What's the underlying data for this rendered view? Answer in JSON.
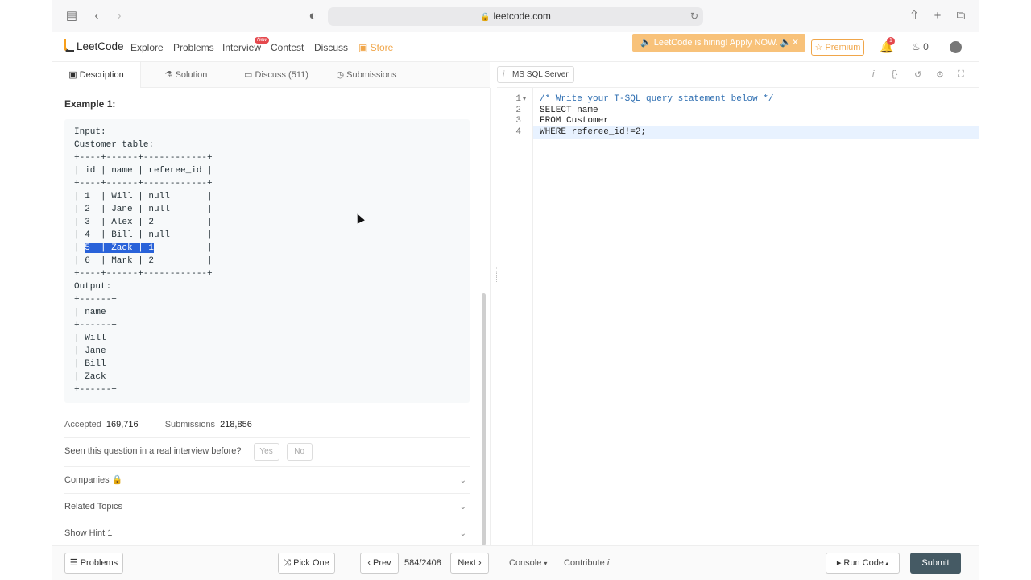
{
  "browser": {
    "url": "leetcode.com"
  },
  "nav": {
    "logo": "LeetCode",
    "links": [
      "Explore",
      "Problems",
      "Interview",
      "Contest",
      "Discuss",
      "Store"
    ],
    "new_badge": "New",
    "hiring": "LeetCode is hiring! Apply NOW.",
    "premium": "Premium",
    "notif_count": "1",
    "coins": "0"
  },
  "tabs": {
    "description": "Description",
    "solution": "Solution",
    "discuss": "Discuss (511)",
    "submissions": "Submissions"
  },
  "problem": {
    "example_title": "Example 1:",
    "code_pre": "Input: \nCustomer table:\n+----+------+------------+\n| id | name | referee_id |\n+----+------+------------+\n| 1  | Will | null       |\n| 2  | Jane | null       |\n| 3  | Alex | 2          |\n| 4  | Bill | null       |\n| ",
    "code_sel": "5  | Zack | 1",
    "code_post": "          |\n| 6  | Mark | 2          |\n+----+------+------------+\nOutput: \n+------+\n| name |\n+------+\n| Will |\n| Jane |\n| Bill |\n| Zack |\n+------+"
  },
  "stats": {
    "accepted_label": "Accepted",
    "accepted_value": "169,716",
    "submissions_label": "Submissions",
    "submissions_value": "218,856"
  },
  "question": {
    "prompt": "Seen this question in a real interview before?",
    "yes": "Yes",
    "no": "No"
  },
  "sections": {
    "companies": "Companies",
    "topics": "Related Topics",
    "hint": "Show Hint 1"
  },
  "editor": {
    "language": "MS SQL Server",
    "lines": [
      "/* Write your T-SQL query statement below */",
      "SELECT name",
      "FROM Customer",
      "WHERE referee_id!=2;"
    ]
  },
  "bottom": {
    "problems": "Problems",
    "pick_one": "Pick One",
    "prev": "Prev",
    "counter": "584/2408",
    "next": "Next",
    "console": "Console",
    "contribute": "Contribute",
    "run_code": "Run Code",
    "submit": "Submit"
  }
}
